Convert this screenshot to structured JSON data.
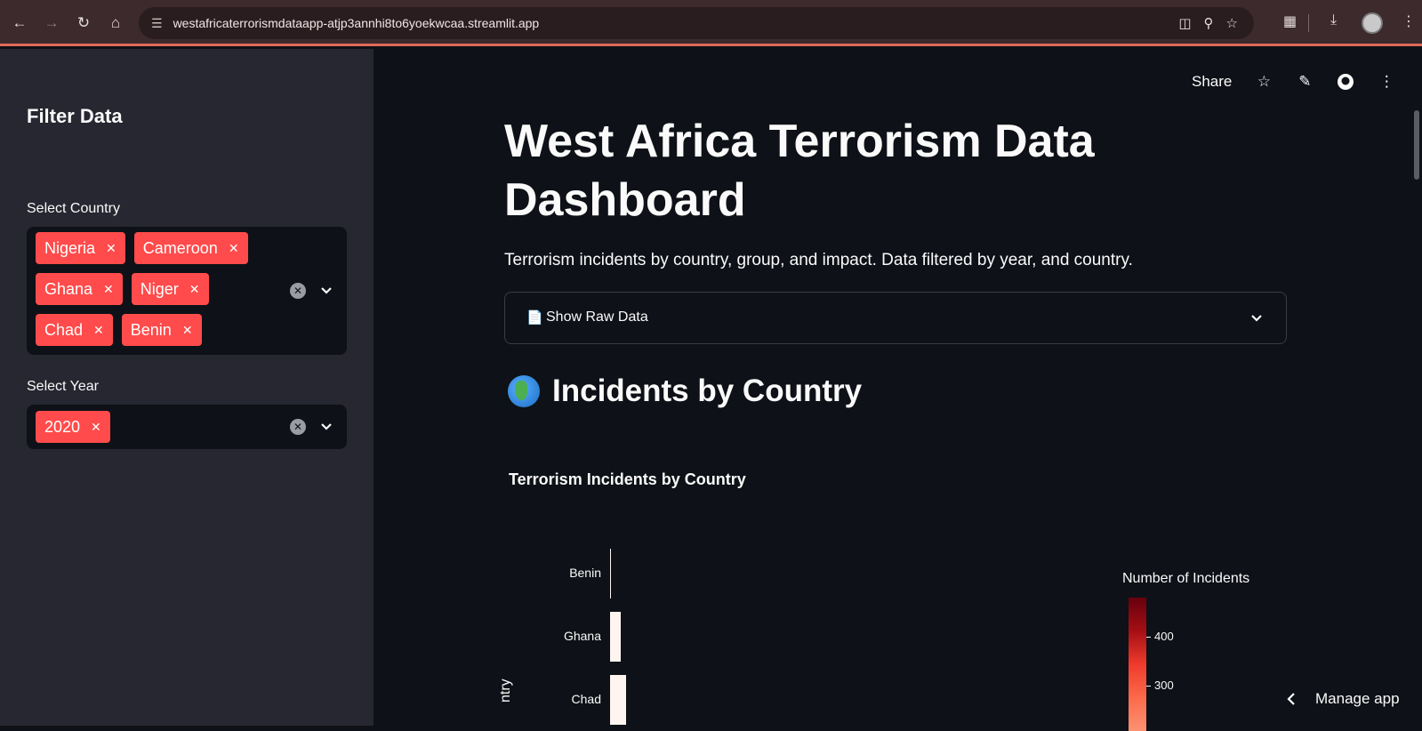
{
  "browser": {
    "url": "westafricaterrorismdataapp-atjp3annhi8to6yoekwcaa.streamlit.app"
  },
  "sidebar": {
    "title": "Filter Data",
    "country": {
      "label": "Select Country",
      "selected": [
        "Nigeria",
        "Cameroon",
        "Ghana",
        "Niger",
        "Chad",
        "Benin"
      ]
    },
    "year": {
      "label": "Select Year",
      "selected": [
        "2020"
      ]
    }
  },
  "toolbar": {
    "share_label": "Share"
  },
  "main": {
    "title": "West Africa Terrorism Data Dashboard",
    "subtitle": "Terrorism incidents by country, group, and impact. Data filtered by year, and country.",
    "expander_label": "Show Raw Data",
    "section_heading": "Incidents by Country"
  },
  "chart_data": {
    "type": "bar",
    "title": "Terrorism Incidents by Country",
    "ylabel": "ntry",
    "categories": [
      "Benin",
      "Ghana",
      "Chad"
    ],
    "values": [
      1,
      10,
      15
    ],
    "colorbar": {
      "title": "Number of Incidents",
      "ticks": [
        "400",
        "300"
      ],
      "colorscale": "Reds"
    }
  },
  "manage_app_label": "Manage app"
}
